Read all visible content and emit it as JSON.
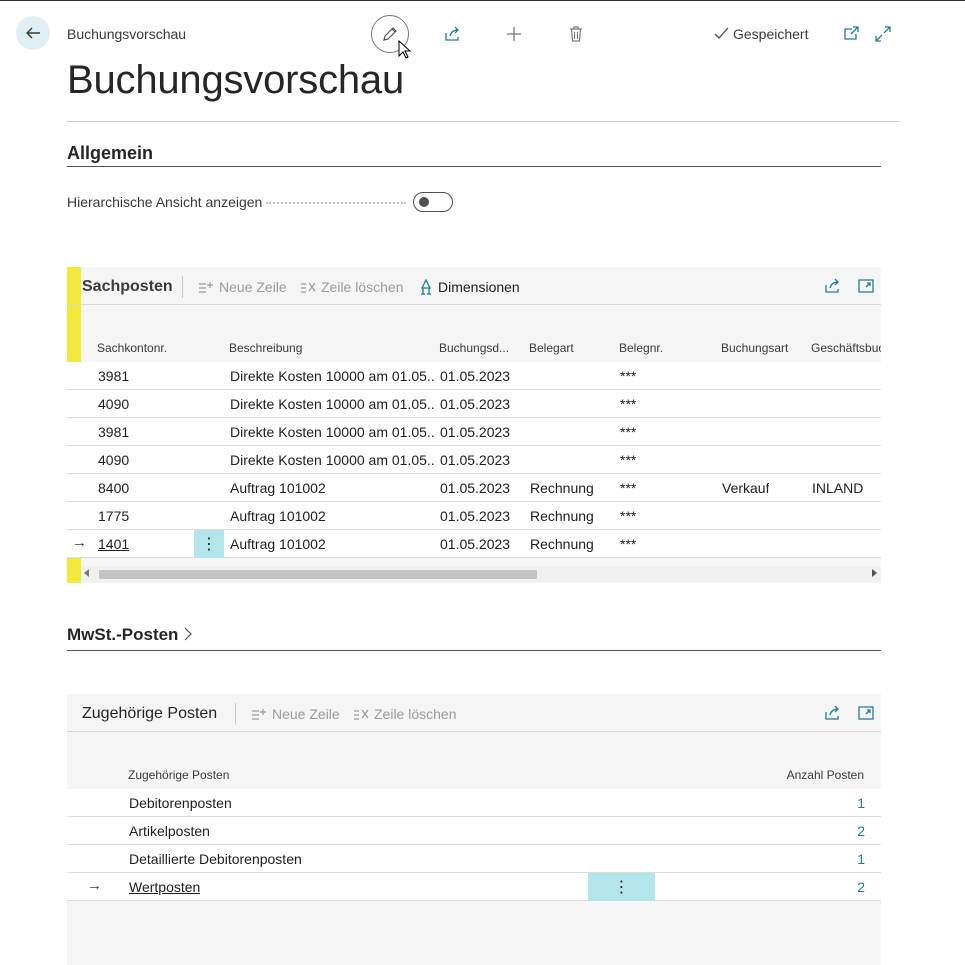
{
  "breadcrumb": "Buchungsvorschau",
  "status": "Gespeichert",
  "page_title": "Buchungsvorschau",
  "general": {
    "title": "Allgemein",
    "field_label": "Hierarchische Ansicht anzeigen",
    "toggle_on": false
  },
  "gl_part": {
    "title": "Sachposten",
    "actions": {
      "new_line": "Neue Zeile",
      "delete_line": "Zeile löschen",
      "dimensions": "Dimensionen"
    },
    "columns": [
      "Sachkontonr.",
      "Beschreibung",
      "Buchungsd...",
      "Belegart",
      "Belegnr.",
      "Buchungsart",
      "Geschäftsbuc"
    ],
    "rows": [
      {
        "account": "3981",
        "desc": "Direkte Kosten 10000 am 01.05...",
        "date": "01.05.2023",
        "doctype": "",
        "docno": "***",
        "posttype": "",
        "bus": ""
      },
      {
        "account": "4090",
        "desc": "Direkte Kosten 10000 am 01.05...",
        "date": "01.05.2023",
        "doctype": "",
        "docno": "***",
        "posttype": "",
        "bus": ""
      },
      {
        "account": "3981",
        "desc": "Direkte Kosten 10000 am 01.05...",
        "date": "01.05.2023",
        "doctype": "",
        "docno": "***",
        "posttype": "",
        "bus": ""
      },
      {
        "account": "4090",
        "desc": "Direkte Kosten 10000 am 01.05...",
        "date": "01.05.2023",
        "doctype": "",
        "docno": "***",
        "posttype": "",
        "bus": ""
      },
      {
        "account": "8400",
        "desc": "Auftrag 101002",
        "date": "01.05.2023",
        "doctype": "Rechnung",
        "docno": "***",
        "posttype": "Verkauf",
        "bus": "INLAND"
      },
      {
        "account": "1775",
        "desc": "Auftrag 101002",
        "date": "01.05.2023",
        "doctype": "Rechnung",
        "docno": "***",
        "posttype": "",
        "bus": ""
      },
      {
        "account": "1401",
        "desc": "Auftrag 101002",
        "date": "01.05.2023",
        "doctype": "Rechnung",
        "docno": "***",
        "posttype": "",
        "bus": ""
      }
    ]
  },
  "vat_section": {
    "title": "MwSt.-Posten"
  },
  "related_part": {
    "title": "Zugehörige Posten",
    "actions": {
      "new_line": "Neue Zeile",
      "delete_line": "Zeile löschen"
    },
    "columns": [
      "Zugehörige Posten",
      "Anzahl Posten"
    ],
    "rows": [
      {
        "name": "Debitorenposten",
        "count": "1"
      },
      {
        "name": "Artikelposten",
        "count": "2"
      },
      {
        "name": "Detaillierte Debitorenposten",
        "count": "1"
      },
      {
        "name": "Wertposten",
        "count": "2"
      }
    ]
  },
  "colors": {
    "accent": "#1f7f8f",
    "selected_bar": "#f2e93d",
    "ellipsis_bg": "#b3e6ec"
  }
}
